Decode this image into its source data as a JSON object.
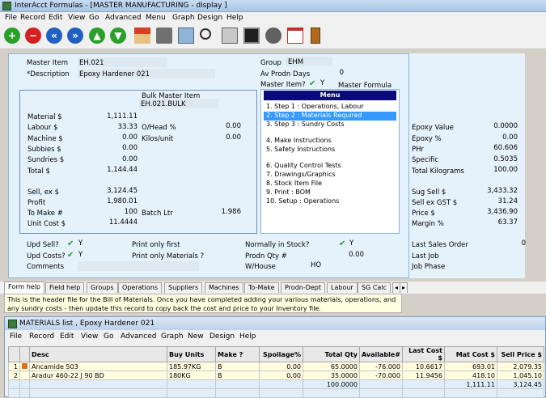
{
  "window": {
    "title": "InterAcct Formulas - [MASTER MANUFACTURING - display ]"
  },
  "menu": [
    "File",
    "Record",
    "Edit",
    "View",
    "Go",
    "Advanced",
    "Menu",
    "Graph",
    "Design",
    "Help"
  ],
  "master": {
    "item_label": "Master Item",
    "item": "EH.021",
    "desc_label": "*Description",
    "desc": "Epoxy Hardener 021",
    "group_label": "Group",
    "group": "EHM",
    "prodn_days_label": "Av Prodn Days",
    "prodn_days": "0",
    "master_item_q": "Master Item?",
    "master_item_val": "Y",
    "master_formula": "Master Formula"
  },
  "bulk": {
    "title": "Bulk Master Item",
    "code": "EH.021.BULK",
    "material_label": "Material $",
    "material": "1,111.11",
    "labour_label": "Labour  $",
    "labour": "33.33",
    "machine_label": "Machine  $",
    "machine": "0.00",
    "subbies_label": "Subbies  $",
    "subbies": "0.00",
    "sundries_label": "Sundries $",
    "sundries": "0.00",
    "total_label": "Total  $",
    "total": "1,144.44",
    "overhead_label": "O/Head %",
    "overhead": "0.00",
    "kilos_label": "Kilos/unit",
    "kilos": "0.00",
    "sell_label": "Sell, ex $",
    "sell": "3,124.45",
    "profit_label": "Profit",
    "profit": "1,980.01",
    "tomake_label": "To Make #",
    "tomake": "100",
    "batch_label": "Batch Ltr",
    "batch": "1.986",
    "unitcost_label": "Unit Cost $",
    "unitcost": "11.4444"
  },
  "menubox": {
    "header": "Menu",
    "items": [
      "1. Step 1 : Operations, Labour",
      "2. Step 2 : Materials Required",
      "3. Step 3 : Sundry Costs",
      "4. Make Instructions",
      "5. Safety Instructions",
      "6. Quality Control Tests",
      "7. Drawings/Graphics",
      "8. Stock Item File",
      "9. Print : BOM",
      "10. Setup : Operations"
    ]
  },
  "right": {
    "epoxy_value_label": "Epoxy Value",
    "epoxy_value": "0.0000",
    "epoxy_pct_label": "Epoxy %",
    "epoxy_pct": "0.00",
    "phr_label": "PHr",
    "phr": "60.606",
    "specific_label": "Specific",
    "specific": "0.5035",
    "total_kg_label": "Total Kilograms",
    "total_kg": "100.00",
    "sug_sell_label": "Sug Sell $",
    "sug_sell": "3,433.32",
    "sell_gst_label": "Sell ex GST $",
    "sell_gst": "31.24",
    "price_label": "Price $",
    "price": "3,436.90",
    "margin_label": "Margin %",
    "margin": "63.37",
    "last_sales_label": "Last Sales Order",
    "last_sales": "0",
    "last_job_label": "Last Job",
    "job_phase_label": "Job Phase"
  },
  "bottom": {
    "upd_sell_label": "Upd Sell?",
    "upd_sell": "Y",
    "upd_costs_label": "Upd Costs?",
    "upd_costs": "Y",
    "comments_label": "Comments",
    "print_first": "Print only first",
    "print_materials": "Print only Materials ?",
    "normally_label": "Normally in Stock?",
    "normally": "Y",
    "prodn_qty_label": "Prodn Qty #",
    "prodn_qty": "0.00",
    "warehouse_label": "W/House",
    "warehouse": "HO"
  },
  "tabs": [
    "Form help",
    "Field help",
    "Groups",
    "Operations",
    "Suppliers",
    "Machines",
    "To-Make",
    "Prodn-Dept",
    "Labour",
    "SG Calc"
  ],
  "help_text": "This is the header file for the Bill of Materials.  Once you have completed adding your various materials, operations, and any sundry costs - then update this record to copy back the cost and price to your Inventory file.",
  "materials": {
    "title": "MATERIALS list , Epoxy Hardener 021",
    "menu": [
      "File",
      "Record",
      "Edit",
      "View",
      "Go",
      "Advanced",
      "Graph",
      "New",
      "Design",
      "Help"
    ],
    "columns": [
      "Desc",
      "Buy Units",
      "Make ?",
      "Spoilage%",
      "Total Qty",
      "Available#",
      "Last Cost  $",
      "Mat Cost  $",
      "Sell Price $"
    ],
    "rows": [
      {
        "n": "1",
        "desc": "Ancamide 503",
        "units": "185.97KG",
        "make": "B",
        "spoil": "0.00",
        "qty": "65.0000",
        "avail": "-76.000",
        "last": "10.6617",
        "mat": "693.01",
        "sell": "2,079.35"
      },
      {
        "n": "2",
        "desc": "Aradur 460-22 J 90 BD",
        "units": "180KG",
        "make": "B",
        "spoil": "0.00",
        "qty": "35.0000",
        "avail": "-70.000",
        "last": "11.9456",
        "mat": "418.10",
        "sell": "1,045.10"
      }
    ],
    "totals": {
      "qty": "100.0000",
      "mat": "1,111.11",
      "sell": "3,124.45"
    }
  }
}
